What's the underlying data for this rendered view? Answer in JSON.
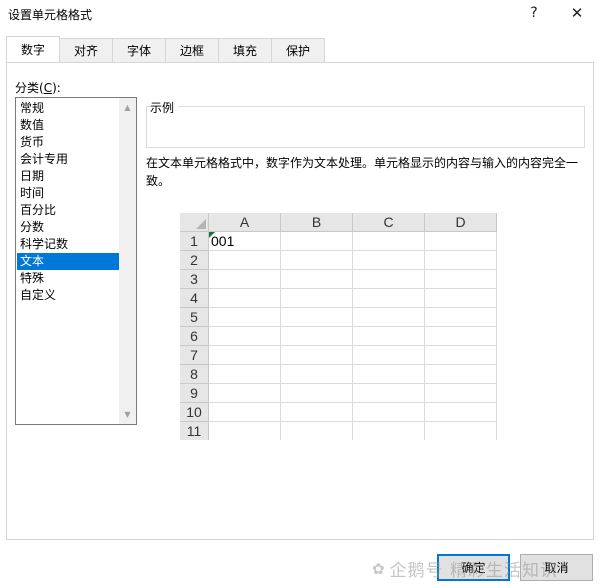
{
  "window": {
    "title": "设置单元格格式",
    "help_glyph": "?",
    "close_glyph": "✕"
  },
  "tabs": [
    {
      "label": "数字",
      "active": true
    },
    {
      "label": "对齐",
      "active": false
    },
    {
      "label": "字体",
      "active": false
    },
    {
      "label": "边框",
      "active": false
    },
    {
      "label": "填充",
      "active": false
    },
    {
      "label": "保护",
      "active": false
    }
  ],
  "category": {
    "label_prefix": "分类(",
    "label_key": "C",
    "label_suffix": "):",
    "items": [
      "常规",
      "数值",
      "货币",
      "会计专用",
      "日期",
      "时间",
      "百分比",
      "分数",
      "科学记数",
      "文本",
      "特殊",
      "自定义"
    ],
    "selected": "文本"
  },
  "sample": {
    "legend": "示例",
    "value": ""
  },
  "description": "在文本单元格格式中，数字作为文本处理。单元格显示的内容与输入的内容完全一致。",
  "grid": {
    "columns": [
      "A",
      "B",
      "C",
      "D"
    ],
    "rows": [
      "1",
      "2",
      "3",
      "4",
      "5",
      "6",
      "7",
      "8",
      "9",
      "10",
      "11"
    ],
    "cell_a1": "001"
  },
  "buttons": {
    "ok": "确定",
    "cancel": "取消"
  },
  "watermark": {
    "icon": "企鹅号",
    "text": "企鹅号 精彩生活知识"
  },
  "colors": {
    "selection": "#0078d7",
    "error_indicator": "#1e7145"
  }
}
